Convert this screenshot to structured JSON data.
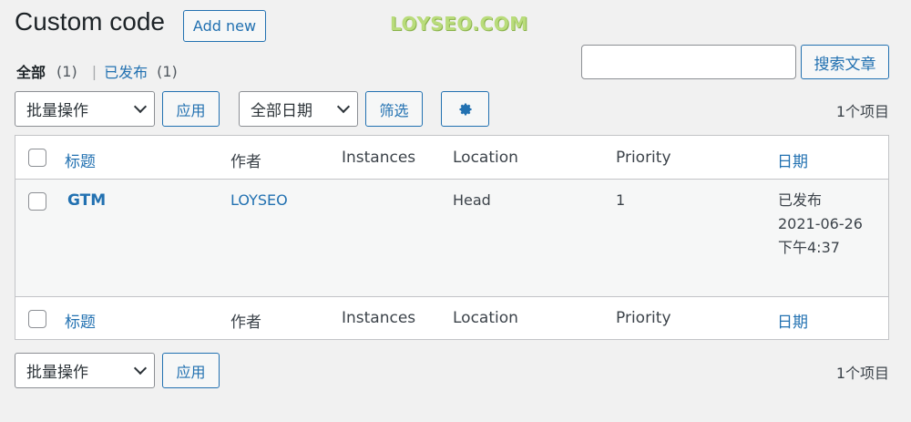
{
  "header": {
    "title": "Custom code",
    "add_new_label": "Add new",
    "watermark": "LOYSEO.COM"
  },
  "views": {
    "all_label": "全部",
    "all_count": "(1)",
    "separator": "|",
    "published_label": "已发布",
    "published_count": "(1)"
  },
  "search": {
    "value": "",
    "button_label": "搜索文章"
  },
  "tablenav_top": {
    "bulk_action_selected": "批量操作",
    "apply_label": "应用",
    "date_filter_selected": "全部日期",
    "filter_label": "筛选",
    "items_count": "1个项目"
  },
  "table": {
    "columns": {
      "title": "标题",
      "author": "作者",
      "instances": "Instances",
      "location": "Location",
      "priority": "Priority",
      "date": "日期"
    },
    "rows": [
      {
        "title": "GTM",
        "author": "LOYSEO",
        "instances": "",
        "location": "Head",
        "priority": "1",
        "date_status": "已发布",
        "date_day": "2021-06-26",
        "date_time": "下午4:37"
      }
    ]
  },
  "tablenav_bottom": {
    "bulk_action_selected": "批量操作",
    "apply_label": "应用",
    "items_count": "1个项目"
  },
  "colors": {
    "accent": "#2271b1",
    "background": "#f1f1f1",
    "watermark": "#b9dc7b"
  }
}
